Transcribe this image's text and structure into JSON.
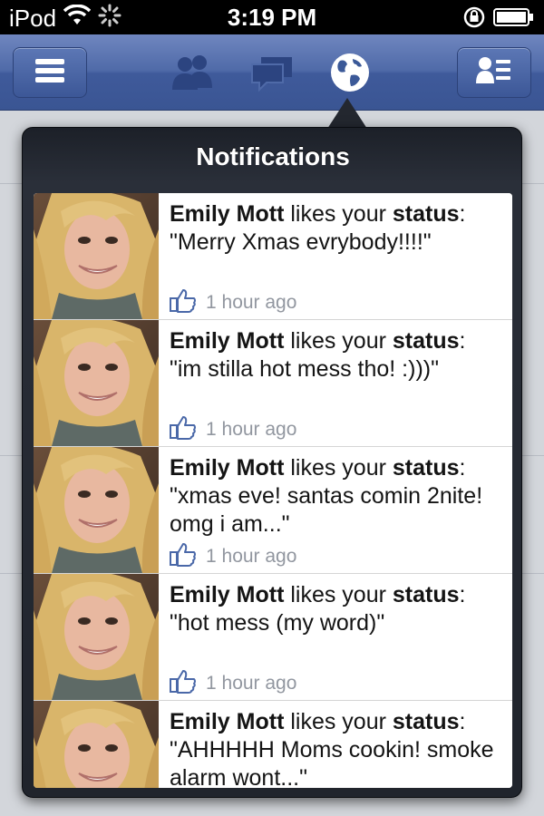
{
  "status_bar": {
    "device": "iPod",
    "time": "3:19 PM",
    "icons": [
      "wifi-icon",
      "activity-spinner-icon",
      "rotation-lock-icon",
      "battery-icon"
    ]
  },
  "navbar": {
    "icons": [
      "menu-icon",
      "friend-requests-icon",
      "messages-icon",
      "notifications-globe-icon",
      "contacts-icon"
    ],
    "accent": "#3b5998"
  },
  "notifications": {
    "title": "Notifications",
    "items": [
      {
        "actor": "Emily Mott",
        "verb": " likes your ",
        "object": "status",
        "punct": ":",
        "quote": "\"Merry Xmas evrybody!!!!\"",
        "time": "1 hour ago"
      },
      {
        "actor": "Emily Mott",
        "verb": " likes your ",
        "object": "status",
        "punct": ":",
        "quote": "\"im stilla hot mess tho! :)))\"",
        "time": "1 hour ago"
      },
      {
        "actor": "Emily Mott",
        "verb": " likes your ",
        "object": "status",
        "punct": ":",
        "quote": "\"xmas eve! santas comin 2nite! omg i am...\"",
        "time": "1 hour ago"
      },
      {
        "actor": "Emily Mott",
        "verb": " likes your ",
        "object": "status",
        "punct": ":",
        "quote": "\"hot mess (my word)\"",
        "time": "1 hour ago"
      },
      {
        "actor": "Emily Mott",
        "verb": " likes your ",
        "object": "status",
        "punct": ":",
        "quote": "\"AHHHHH Moms cookin! smoke alarm wont...\"",
        "time": ""
      }
    ]
  }
}
